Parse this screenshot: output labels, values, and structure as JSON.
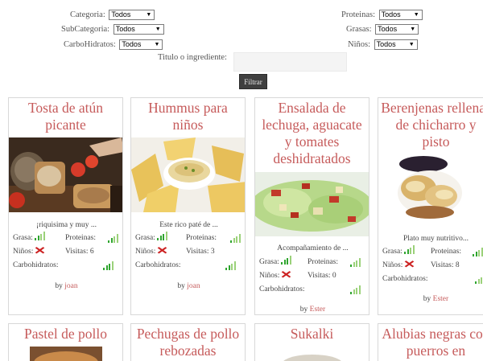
{
  "filters": {
    "categoria": {
      "label": "Categoria:",
      "value": "Todos"
    },
    "subcategoria": {
      "label": "SubCategoria:",
      "value": "Todos"
    },
    "carbohidratos": {
      "label": "CarboHidratos:",
      "value": "Todos"
    },
    "proteinas": {
      "label": "Proteinas:",
      "value": "Todos"
    },
    "grasas": {
      "label": "Grasas:",
      "value": "Todos"
    },
    "ninos": {
      "label": "Niños:",
      "value": "Todos"
    },
    "titulo_label": "Titulo o ingrediente:",
    "titulo_value": "",
    "filtrar_label": "Filtrar"
  },
  "labels": {
    "grasa": "Grasa:",
    "proteinas": "Proteinas:",
    "ninos": "Niños:",
    "visitas": "Visitas:",
    "carbohidratos": "Carbohidratos:",
    "by": "by"
  },
  "recipes": [
    {
      "title": "Tosta de atún picante",
      "desc": "¡riquisima y muy ...",
      "visitas": "Visitas: 6",
      "author": "joan",
      "grasa_level": 2,
      "proteinas_level": 2,
      "carbohidratos_level": 3
    },
    {
      "title": "Hummus para niños",
      "desc": "Este rico paté de ...",
      "visitas": "Visitas: 3",
      "author": "joan",
      "grasa_level": 3,
      "proteinas_level": 1,
      "carbohidratos_level": 2
    },
    {
      "title": "Ensalada de lechuga, aguacate y tomates deshidratados",
      "desc": "Acompañamiento de ...",
      "visitas": "Visitas: 0",
      "author": "Ester",
      "grasa_level": 3,
      "proteinas_level": 1,
      "carbohidratos_level": 1
    },
    {
      "title": "Berenjenas rellenas de chicharro y pisto",
      "desc": "Plato muy nutritivo...",
      "visitas": "Visitas: 8",
      "author": "Ester",
      "grasa_level": 2,
      "proteinas_level": 2,
      "carbohidratos_level": 1
    },
    {
      "title": "Pastel de pollo"
    },
    {
      "title": "Pechugas de pollo rebozadas"
    },
    {
      "title": "Sukalki"
    },
    {
      "title": "Alubias negras con puerros en"
    }
  ]
}
